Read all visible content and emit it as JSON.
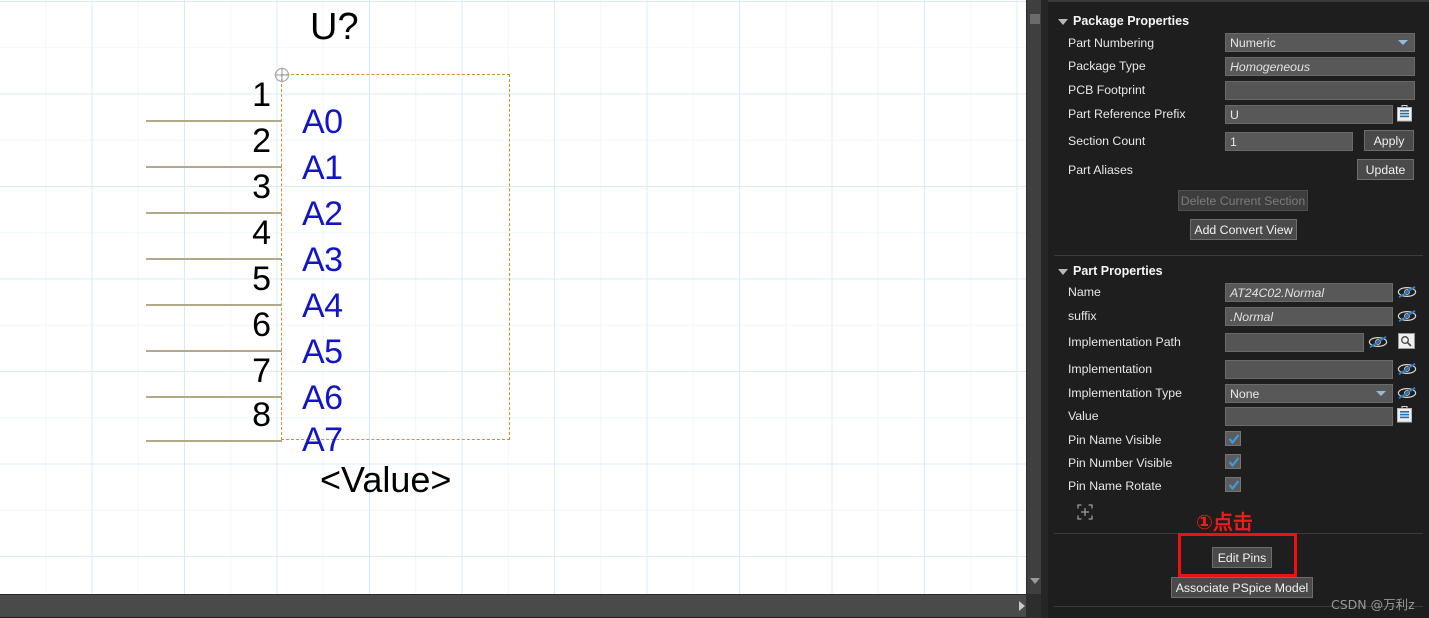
{
  "canvas": {
    "refdes": "U?",
    "value_label": "<Value>",
    "pins": [
      {
        "number": "1",
        "name": "A0"
      },
      {
        "number": "2",
        "name": "A1"
      },
      {
        "number": "3",
        "name": "A2"
      },
      {
        "number": "4",
        "name": "A3"
      },
      {
        "number": "5",
        "name": "A4"
      },
      {
        "number": "6",
        "name": "A5"
      },
      {
        "number": "7",
        "name": "A6"
      },
      {
        "number": "8",
        "name": "A7"
      }
    ],
    "colors": {
      "pin_name": "#1214c8",
      "pin_number": "#000000",
      "body_outline": "#c8922c",
      "wire": "#b3a888",
      "grid": "#d7ecfb"
    }
  },
  "package_properties": {
    "title": "Package Properties",
    "part_numbering": {
      "label": "Part Numbering",
      "value": "Numeric"
    },
    "package_type": {
      "label": "Package Type",
      "value": "Homogeneous"
    },
    "pcb_footprint": {
      "label": "PCB Footprint",
      "value": ""
    },
    "part_reference_prefix": {
      "label": "Part Reference Prefix",
      "value": "U"
    },
    "section_count": {
      "label": "Section Count",
      "value": "1"
    },
    "part_aliases": {
      "label": "Part Aliases",
      "value": ""
    },
    "apply_button": "Apply",
    "update_button": "Update",
    "delete_current_section_button": "Delete Current Section",
    "add_convert_view_button": "Add Convert View"
  },
  "part_properties": {
    "title": "Part Properties",
    "name": {
      "label": "Name",
      "value": "AT24C02.Normal"
    },
    "suffix": {
      "label": "suffix",
      "value": ".Normal"
    },
    "implementation_path": {
      "label": "Implementation Path",
      "value": ""
    },
    "implementation": {
      "label": "Implementation",
      "value": ""
    },
    "implementation_type": {
      "label": "Implementation Type",
      "value": "None"
    },
    "value": {
      "label": "Value",
      "value": ""
    },
    "pin_name_visible": {
      "label": "Pin Name Visible",
      "checked": true
    },
    "pin_number_visible": {
      "label": "Pin Number Visible",
      "checked": true
    },
    "pin_name_rotate": {
      "label": "Pin Name Rotate",
      "checked": true
    }
  },
  "footer": {
    "edit_pins_button": "Edit Pins",
    "associate_pspice_model_button": "Associate PSpice Model"
  },
  "annotations": {
    "step_one": "①点击",
    "accent_color": "#f01010"
  },
  "watermark": {
    "text": "CSDN @万利z"
  }
}
